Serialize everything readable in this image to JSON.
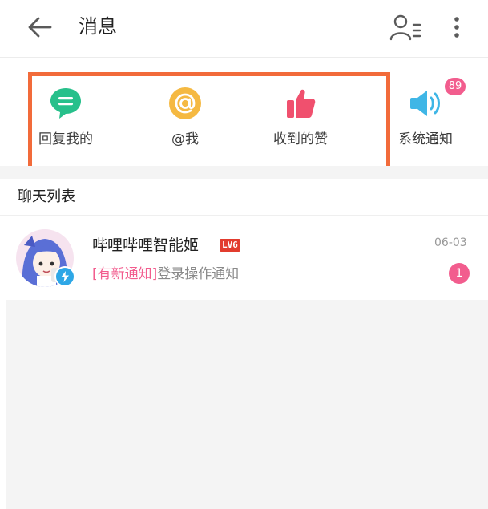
{
  "header": {
    "title": "消息",
    "back_icon": "arrow-left-icon",
    "contacts_icon": "contacts-list-icon",
    "more_icon": "more-vertical-icon"
  },
  "quick_actions": [
    {
      "label": "回复我的",
      "icon": "reply-bubble-icon",
      "color": "#27c08b"
    },
    {
      "label": "@我",
      "icon": "at-sign-icon",
      "color": "#f5b942"
    },
    {
      "label": "收到的赞",
      "icon": "thumbs-up-icon",
      "color": "#f0506e"
    },
    {
      "label": "系统通知",
      "icon": "speaker-icon",
      "color": "#3fb6e6",
      "badge": "89"
    }
  ],
  "chat_list": {
    "header": "聊天列表",
    "items": [
      {
        "name": "哔哩哔哩智能姬",
        "level_badge": "LV6",
        "preview_tag": "[有新通知]",
        "preview_text": "登录操作通知",
        "time": "06-03",
        "unread": "1"
      }
    ]
  },
  "colors": {
    "accent_pink": "#f25d8e",
    "highlight_orange": "#f26b3a",
    "background_gray": "#f4f4f4"
  }
}
